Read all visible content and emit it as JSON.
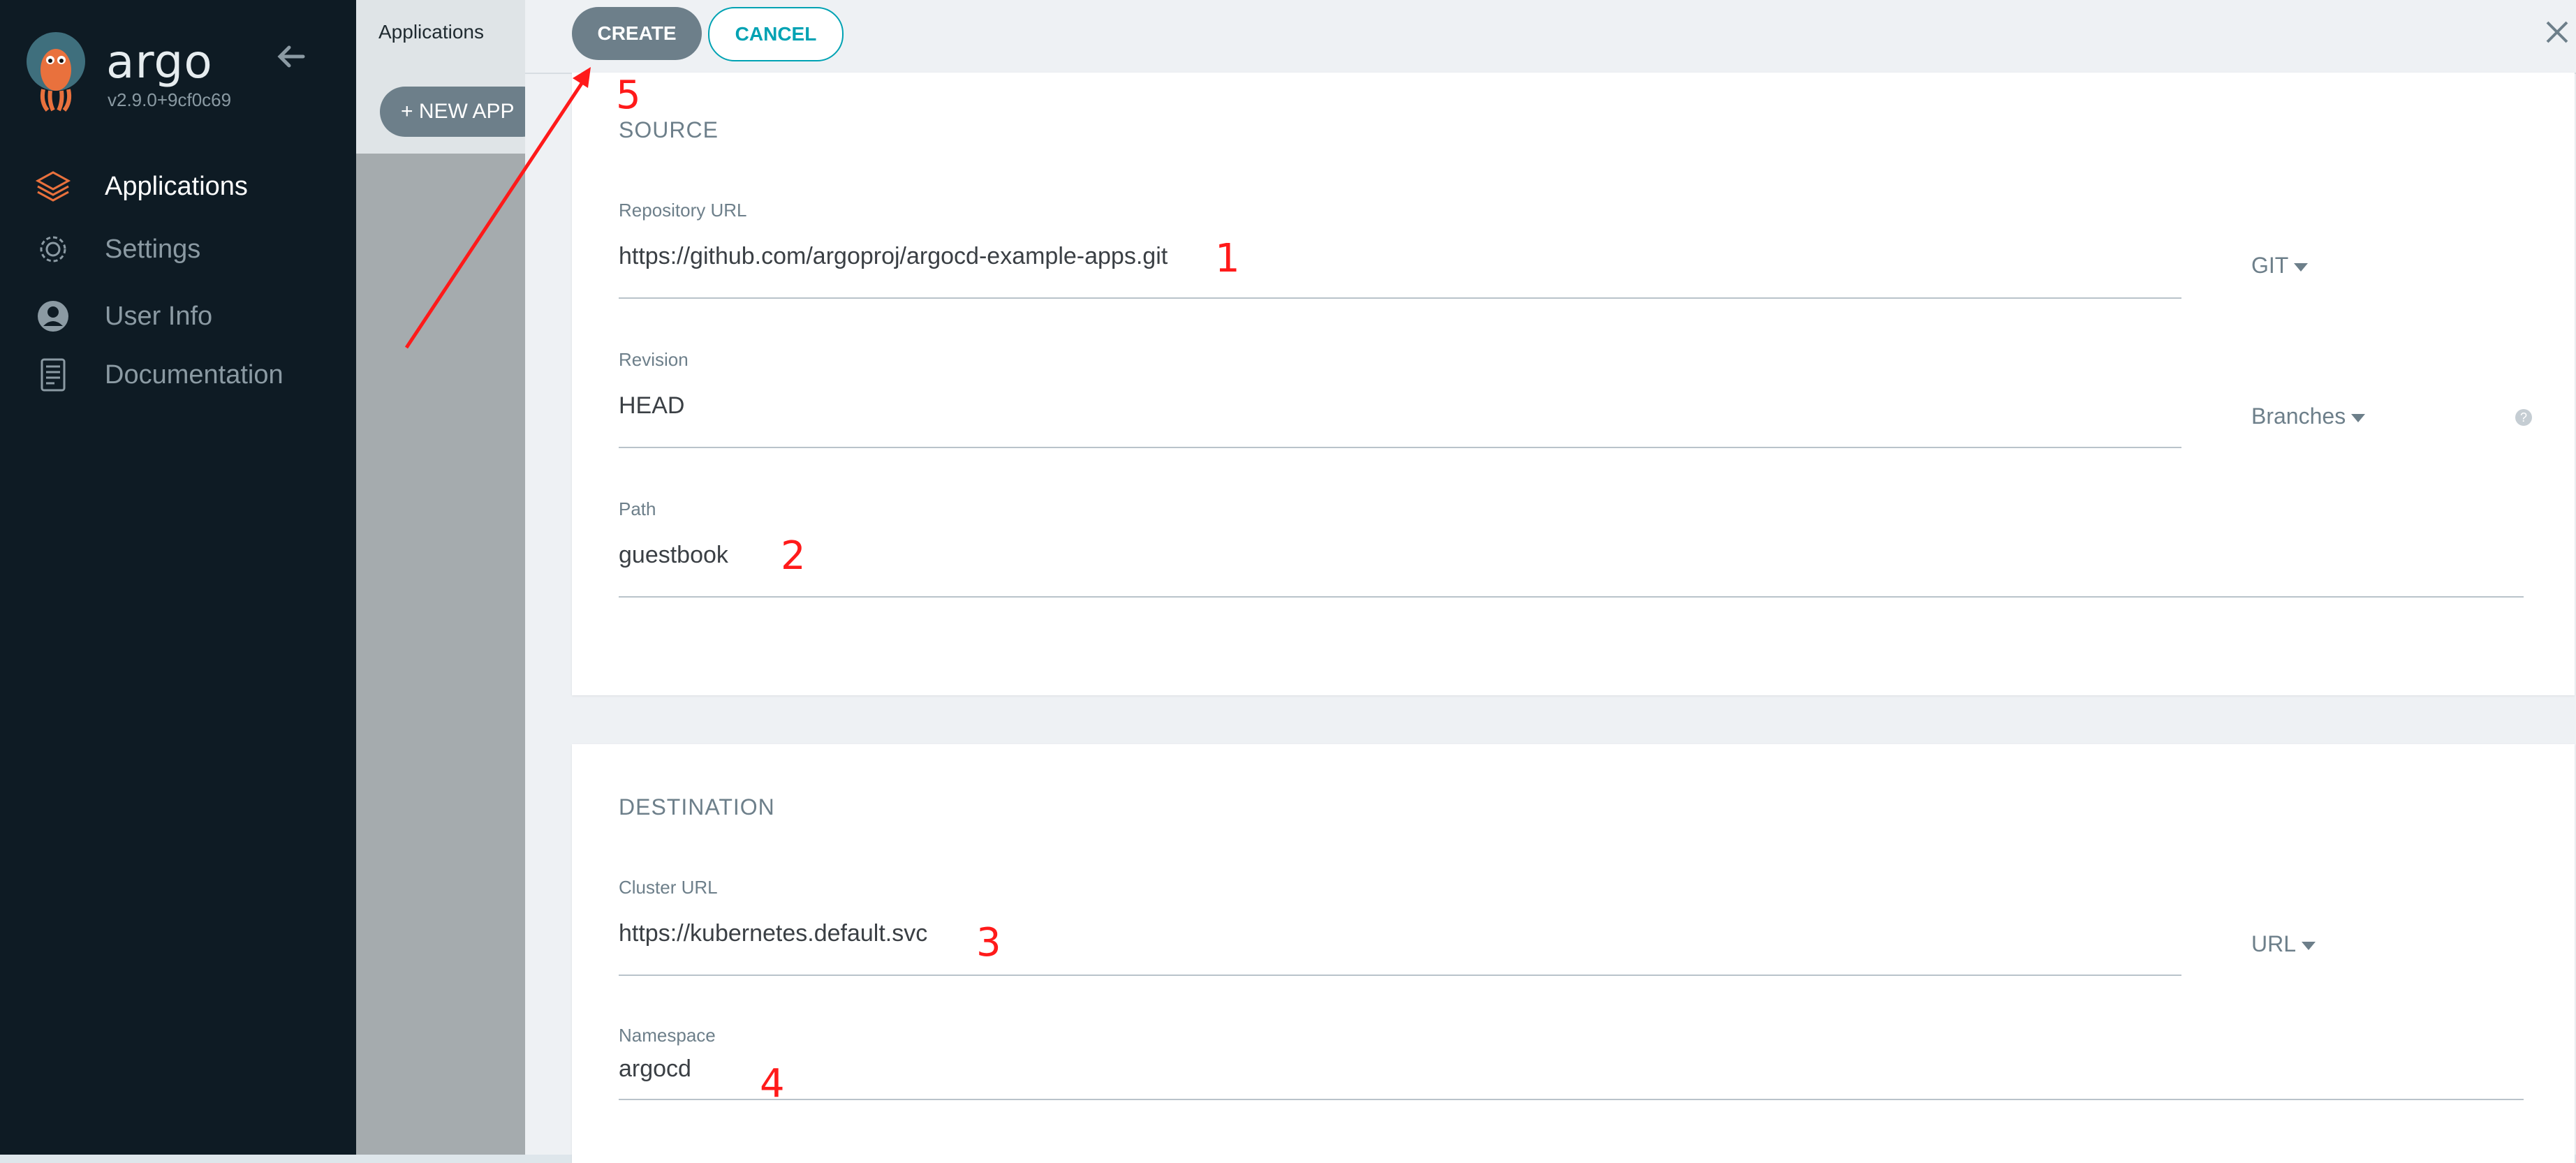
{
  "sidebar": {
    "brand": "argo",
    "version": "v2.9.0+9cf0c69",
    "items": [
      {
        "label": "Applications",
        "icon": "layers-icon",
        "active": true
      },
      {
        "label": "Settings",
        "icon": "gear-icon",
        "active": false
      },
      {
        "label": "User Info",
        "icon": "user-icon",
        "active": false
      },
      {
        "label": "Documentation",
        "icon": "document-icon",
        "active": false
      }
    ]
  },
  "applications_panel": {
    "title": "Applications",
    "new_app_label": "+ NEW APP"
  },
  "toolbar": {
    "create_label": "CREATE",
    "cancel_label": "CANCEL"
  },
  "source": {
    "title": "SOURCE",
    "repo_url": {
      "label": "Repository URL",
      "value": "https://github.com/argoproj/argocd-example-apps.git",
      "type": "GIT"
    },
    "revision": {
      "label": "Revision",
      "value": "HEAD",
      "type": "Branches"
    },
    "path": {
      "label": "Path",
      "value": "guestbook"
    }
  },
  "destination": {
    "title": "DESTINATION",
    "cluster_url": {
      "label": "Cluster URL",
      "value": "https://kubernetes.default.svc",
      "type": "URL"
    },
    "namespace": {
      "label": "Namespace",
      "value": "argocd"
    }
  },
  "annotations": [
    "1",
    "2",
    "3",
    "4",
    "5"
  ],
  "colors": {
    "sidebar_bg": "#0e1b24",
    "accent_teal": "#00a2b3",
    "button_gray": "#6d7f8a",
    "annotation_red": "#ff1a1a"
  }
}
